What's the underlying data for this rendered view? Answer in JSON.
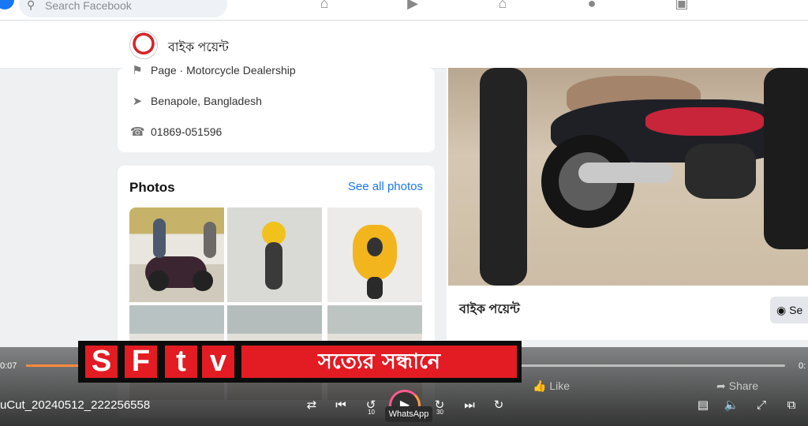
{
  "topbar": {
    "search_placeholder": "Search Facebook"
  },
  "page": {
    "name": "বাইক পয়েন্ট",
    "category": "Page · Motorcycle Dealership",
    "location": "Benapole, Bangladesh",
    "phone": "01869-051596"
  },
  "photos": {
    "title": "Photos",
    "see_all": "See all photos"
  },
  "post": {
    "author": "বাইক পয়েন্ট",
    "message_button": "Se"
  },
  "actions": {
    "like": "Like",
    "share": "Share"
  },
  "player": {
    "file_name": "uCut_20240512_222256558",
    "time_elapsed": "0:07",
    "time_total": "0:",
    "progress_fraction": 0.07,
    "skip_back_seconds": "10",
    "skip_forward_seconds": "30",
    "tooltip": "WhatsApp"
  },
  "banner": {
    "letters": [
      "S",
      "F",
      "t",
      "v"
    ],
    "tagline": "সত্যের সন্ধানে"
  },
  "colors": {
    "banner_red": "#e31b23",
    "progress": "#ff8a3d",
    "link": "#1877f2"
  }
}
